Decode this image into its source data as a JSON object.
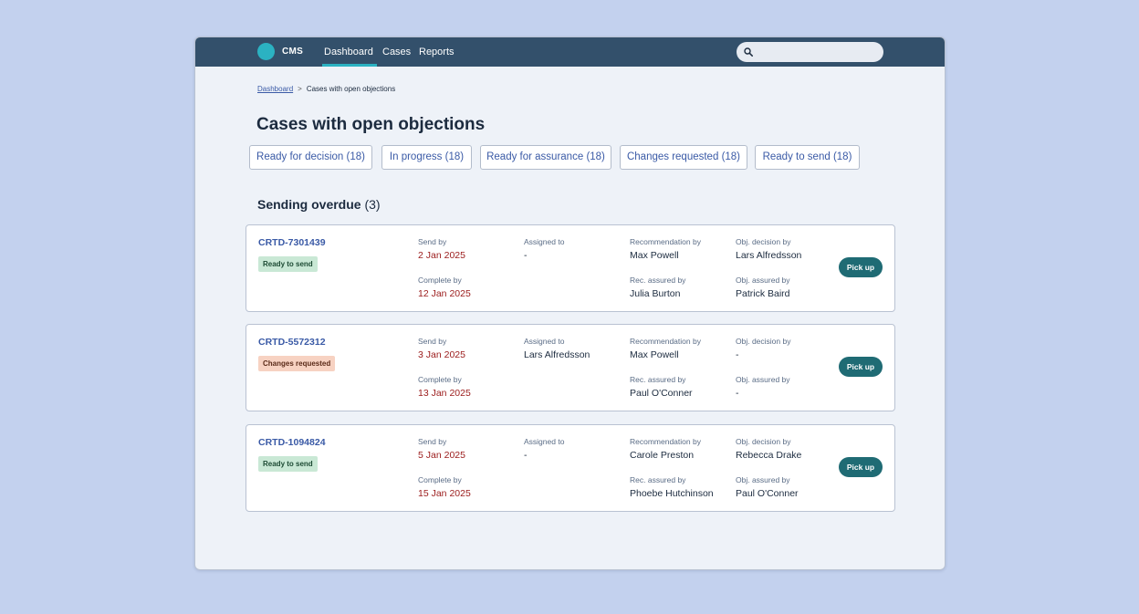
{
  "app": {
    "brand": "CMS",
    "nav": [
      {
        "label": "Dashboard",
        "active": true
      },
      {
        "label": "Cases",
        "active": false
      },
      {
        "label": "Reports",
        "active": false
      }
    ],
    "search": {
      "placeholder": "",
      "value": ""
    }
  },
  "breadcrumb": {
    "home": "Dashboard",
    "separator": ">",
    "current": "Cases with open objections"
  },
  "page_title": "Cases with open objections",
  "tabs": [
    {
      "label": "Ready for decision",
      "count": "(18)"
    },
    {
      "label": "In progress",
      "count": "(18)"
    },
    {
      "label": "Ready for assurance",
      "count": "(18)"
    },
    {
      "label": "Changes requested",
      "count": "(18)"
    },
    {
      "label": "Ready to send",
      "count": "(18)"
    }
  ],
  "section": {
    "title": "Sending overdue",
    "count": "(3)"
  },
  "labels": {
    "send_by": "Send by",
    "complete_by": "Complete by",
    "assigned_to": "Assigned to",
    "recommendation_by": "Recommendation by",
    "rec_assured_by": "Rec. assured by",
    "obj_decision_by": "Obj. decision by",
    "obj_assured_by": "Obj. assured by",
    "pick_up": "Pick up"
  },
  "cases": [
    {
      "id": "CRTD-7301439",
      "status": "Ready to send",
      "status_type": "ready",
      "send_by": "2 Jan 2025",
      "complete_by": "12 Jan 2025",
      "assigned_to": "-",
      "recommendation_by": "Max Powell",
      "rec_assured_by": "Julia Burton",
      "obj_decision_by": "Lars Alfredsson",
      "obj_assured_by": "Patrick Baird"
    },
    {
      "id": "CRTD-5572312",
      "status": "Changes requested",
      "status_type": "changes",
      "send_by": "3 Jan 2025",
      "complete_by": "13 Jan 2025",
      "assigned_to": "Lars Alfredsson",
      "recommendation_by": "Max Powell",
      "rec_assured_by": "Paul O'Conner",
      "obj_decision_by": "-",
      "obj_assured_by": "-"
    },
    {
      "id": "CRTD-1094824",
      "status": "Ready to send",
      "status_type": "ready",
      "send_by": "5 Jan 2025",
      "complete_by": "15 Jan 2025",
      "assigned_to": "-",
      "recommendation_by": "Carole Preston",
      "rec_assured_by": "Phoebe Hutchinson",
      "obj_decision_by": "Rebecca Drake",
      "obj_assured_by": "Paul O'Conner"
    }
  ],
  "colors": {
    "navbar": "#33506b",
    "accent": "#2bb2c2",
    "link": "#3a5aa6",
    "overdue_date": "#9b1b1b",
    "pick_up_button": "#1f6b74",
    "status_ready_bg": "#c9e8d5",
    "status_changes_bg": "#f7d2c2"
  }
}
